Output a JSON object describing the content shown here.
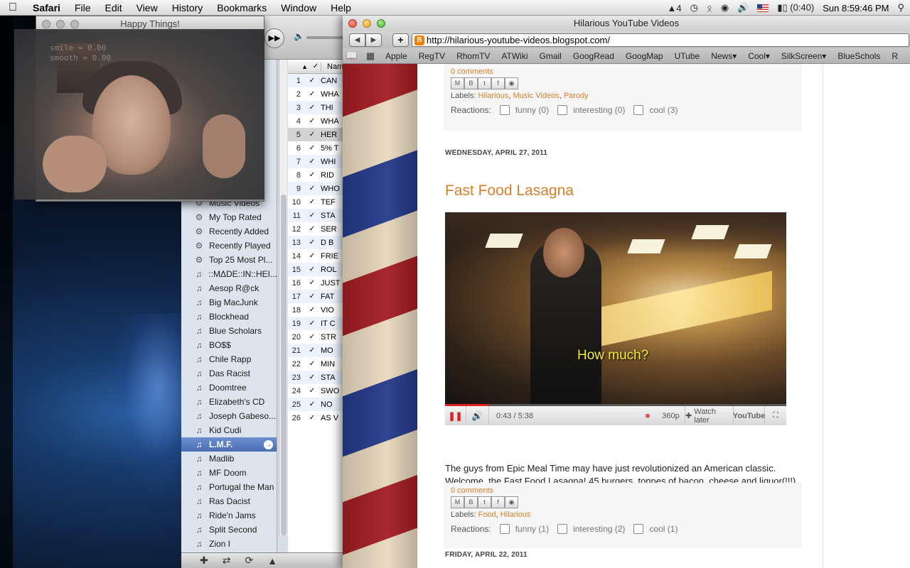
{
  "menubar": {
    "app_name": "Safari",
    "items": [
      "File",
      "Edit",
      "View",
      "History",
      "Bookmarks",
      "Window",
      "Help"
    ],
    "status": {
      "adobe_count": "4",
      "battery_text": "(0:40)",
      "clock": "Sun 8:59:46 PM"
    }
  },
  "happy_things": {
    "title": "Happy Things!",
    "overlay_line1": "smile = 0.00",
    "overlay_line2": "smooth = 0.00"
  },
  "itunes": {
    "column_name": "Nam",
    "sources": [
      {
        "label": "Music Videos",
        "icon": "gear-icon"
      },
      {
        "label": "My Top Rated",
        "icon": "gear-icon"
      },
      {
        "label": "Recently Added",
        "icon": "gear-icon"
      },
      {
        "label": "Recently Played",
        "icon": "gear-icon"
      },
      {
        "label": "Top 25 Most Pl...",
        "icon": "gear-icon"
      },
      {
        "label": "::MΔDE::IN::HEI...",
        "icon": "playlist-icon"
      },
      {
        "label": "Aesop R@ck",
        "icon": "playlist-icon"
      },
      {
        "label": "Big MacJunk",
        "icon": "playlist-icon"
      },
      {
        "label": "Blockhead",
        "icon": "playlist-icon"
      },
      {
        "label": "Blue Scholars",
        "icon": "playlist-icon"
      },
      {
        "label": "BO$$",
        "icon": "playlist-icon"
      },
      {
        "label": "Chile Rapp",
        "icon": "playlist-icon"
      },
      {
        "label": "Das Racist",
        "icon": "playlist-icon"
      },
      {
        "label": "Doomtree",
        "icon": "playlist-icon"
      },
      {
        "label": "Elizabeth's CD",
        "icon": "playlist-icon"
      },
      {
        "label": "Joseph Gabeso...",
        "icon": "playlist-icon"
      },
      {
        "label": "Kid Cudi",
        "icon": "playlist-icon"
      },
      {
        "label": "L.M.F.",
        "icon": "playlist-icon",
        "selected": true
      },
      {
        "label": "Madlib",
        "icon": "playlist-icon"
      },
      {
        "label": "MF Doom",
        "icon": "playlist-icon"
      },
      {
        "label": "Portugal the Man",
        "icon": "playlist-icon"
      },
      {
        "label": "Ras Dacist",
        "icon": "playlist-icon"
      },
      {
        "label": "Ride'n Jams",
        "icon": "playlist-icon"
      },
      {
        "label": "Split Second",
        "icon": "playlist-icon"
      },
      {
        "label": "Zion I",
        "icon": "playlist-icon"
      }
    ],
    "tracks": [
      {
        "num": "1",
        "name": "CAN"
      },
      {
        "num": "2",
        "name": "WHA"
      },
      {
        "num": "3",
        "name": "THI"
      },
      {
        "num": "4",
        "name": "WHA"
      },
      {
        "num": "5",
        "name": "HER"
      },
      {
        "num": "6",
        "name": "5% T"
      },
      {
        "num": "7",
        "name": "WHI"
      },
      {
        "num": "8",
        "name": "RID"
      },
      {
        "num": "9",
        "name": "WHO"
      },
      {
        "num": "10",
        "name": "TEF"
      },
      {
        "num": "11",
        "name": "STA"
      },
      {
        "num": "12",
        "name": "SER"
      },
      {
        "num": "13",
        "name": "D B"
      },
      {
        "num": "14",
        "name": "FRIE"
      },
      {
        "num": "15",
        "name": "ROL"
      },
      {
        "num": "16",
        "name": "JUST"
      },
      {
        "num": "17",
        "name": "FAT"
      },
      {
        "num": "18",
        "name": "VIO"
      },
      {
        "num": "19",
        "name": "IT C"
      },
      {
        "num": "20",
        "name": "STR"
      },
      {
        "num": "21",
        "name": "MO"
      },
      {
        "num": "22",
        "name": "MIN"
      },
      {
        "num": "23",
        "name": "STA"
      },
      {
        "num": "24",
        "name": "SWO"
      },
      {
        "num": "25",
        "name": "NO"
      },
      {
        "num": "26",
        "name": "AS V"
      }
    ]
  },
  "safari": {
    "title": "Hilarious YouTube Videos",
    "url": "http://hilarious-youtube-videos.blogspot.com/",
    "bookmarks": [
      "Apple",
      "RegTV",
      "RhomTV",
      "ATWiki",
      "Gmail",
      "GoogRead",
      "GoogMap",
      "UTube",
      "News▾",
      "Cool▾",
      "SilkScreen▾",
      "BlueSchols",
      "R"
    ]
  },
  "blog": {
    "prev_post": {
      "comments": "0 comments",
      "labels_prefix": "Labels:",
      "labels": [
        "Hilarious",
        "Music Videos",
        "Parody"
      ],
      "reactions_label": "Reactions:",
      "reactions": [
        {
          "label": "funny (0)"
        },
        {
          "label": "interesting (0)"
        },
        {
          "label": "cool (3)"
        }
      ]
    },
    "date1": "WEDNESDAY, APRIL 27, 2011",
    "post_title": "Fast Food Lasagna",
    "video": {
      "caption": "How much?",
      "time": "0:43 / 5:38",
      "quality": "360p",
      "watch_later": "Watch later",
      "logo": "YouTube",
      "progress_fraction": 0.127
    },
    "body": "The guys from Epic Meal Time may have just revolutionized an American classic. Welcome, the Fast Food Lasagna! 45 burgers, tonnes of bacon, cheese and liquor(!!!) This is going to be the future classic, mark my words!",
    "post_footer": {
      "comments": "0 comments",
      "labels_prefix": "Labels:",
      "labels": [
        "Food",
        "Hilarious"
      ],
      "reactions_label": "Reactions:",
      "reactions": [
        {
          "label": "funny (1)"
        },
        {
          "label": "interesting (2)"
        },
        {
          "label": "cool (1)"
        }
      ]
    },
    "date2": "FRIDAY, APRIL 22, 2011"
  }
}
